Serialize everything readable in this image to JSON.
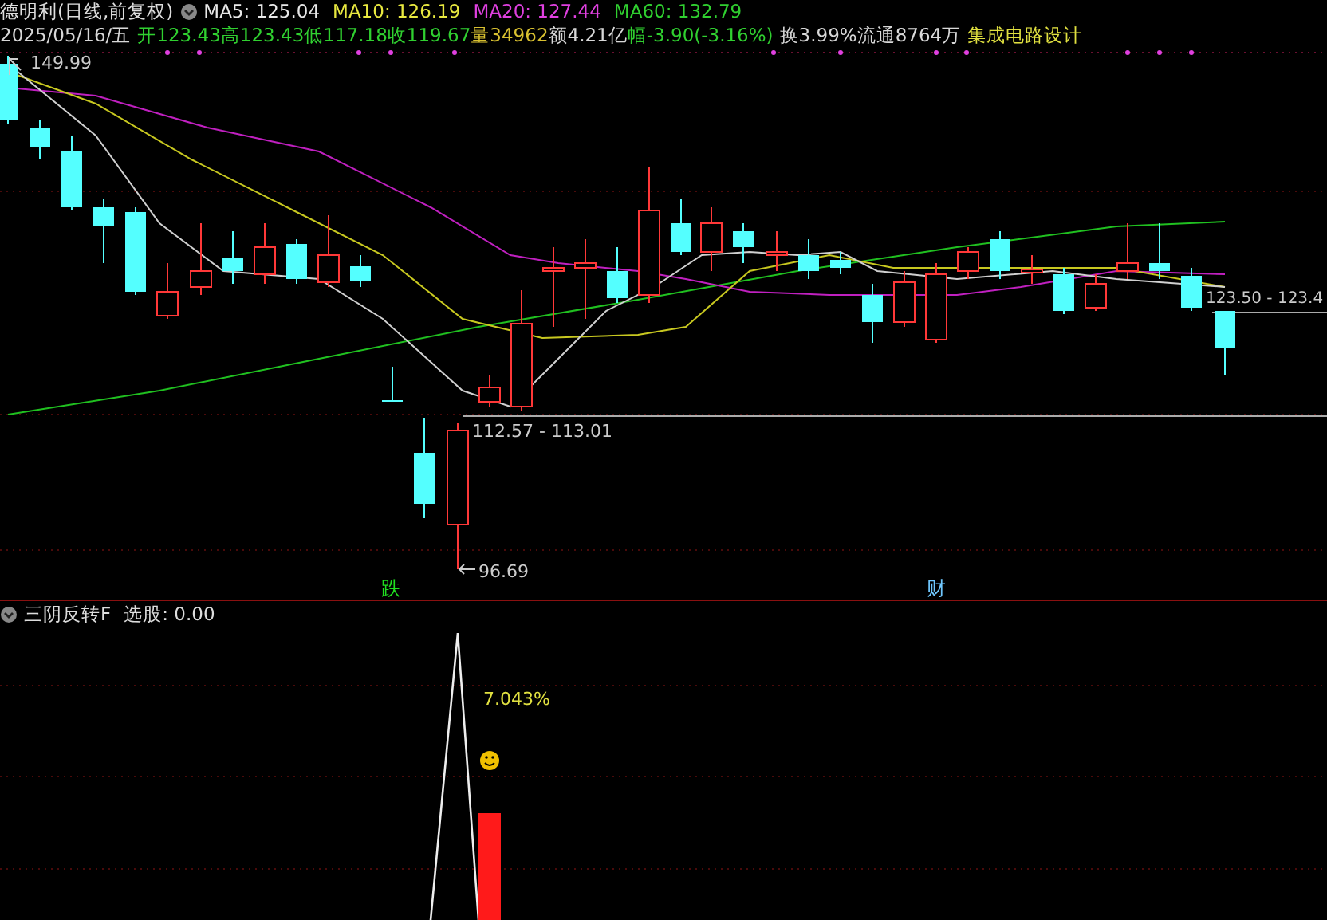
{
  "header": {
    "title": "德明利(日线,前复权)",
    "indicators": [
      {
        "text": "MA5: 125.04",
        "color": "#e8e8e8"
      },
      {
        "text": "MA10: 126.19",
        "color": "#e8e840"
      },
      {
        "text": "MA20: 127.44",
        "color": "#e040e0"
      },
      {
        "text": "MA60: 132.79",
        "color": "#30d030"
      }
    ]
  },
  "quote": [
    {
      "text": "2025/05/16/五",
      "color": "#d8d8d8"
    },
    {
      "text": "开123.43",
      "color": "#30d030"
    },
    {
      "text": "高123.43",
      "color": "#30d030"
    },
    {
      "text": "低117.18",
      "color": "#30d030"
    },
    {
      "text": "收119.67",
      "color": "#30d030"
    },
    {
      "text": "量34962",
      "color": "#d8c030"
    },
    {
      "text": "额4.21亿",
      "color": "#d8d8d8"
    },
    {
      "text": "幅-3.90(-3.16%)",
      "color": "#30d030"
    },
    {
      "text": "换3.99%",
      "color": "#d8d8d8"
    },
    {
      "text": "流通8764万",
      "color": "#d8d8d8"
    },
    {
      "text": "集成电路设计",
      "color": "#e0e040"
    }
  ],
  "price_labels": {
    "high": "149.99",
    "last": "123.50 - 123.4",
    "range": "112.57 - 113.01",
    "low": "96.69"
  },
  "markers": [
    {
      "text": "跌",
      "color": "#20e020"
    },
    {
      "text": "财",
      "color": "#70c8ff"
    }
  ],
  "indicator_panel": {
    "title": "三阴反转F",
    "value": "选股: 0.00",
    "annotation": "7.043%"
  }
}
